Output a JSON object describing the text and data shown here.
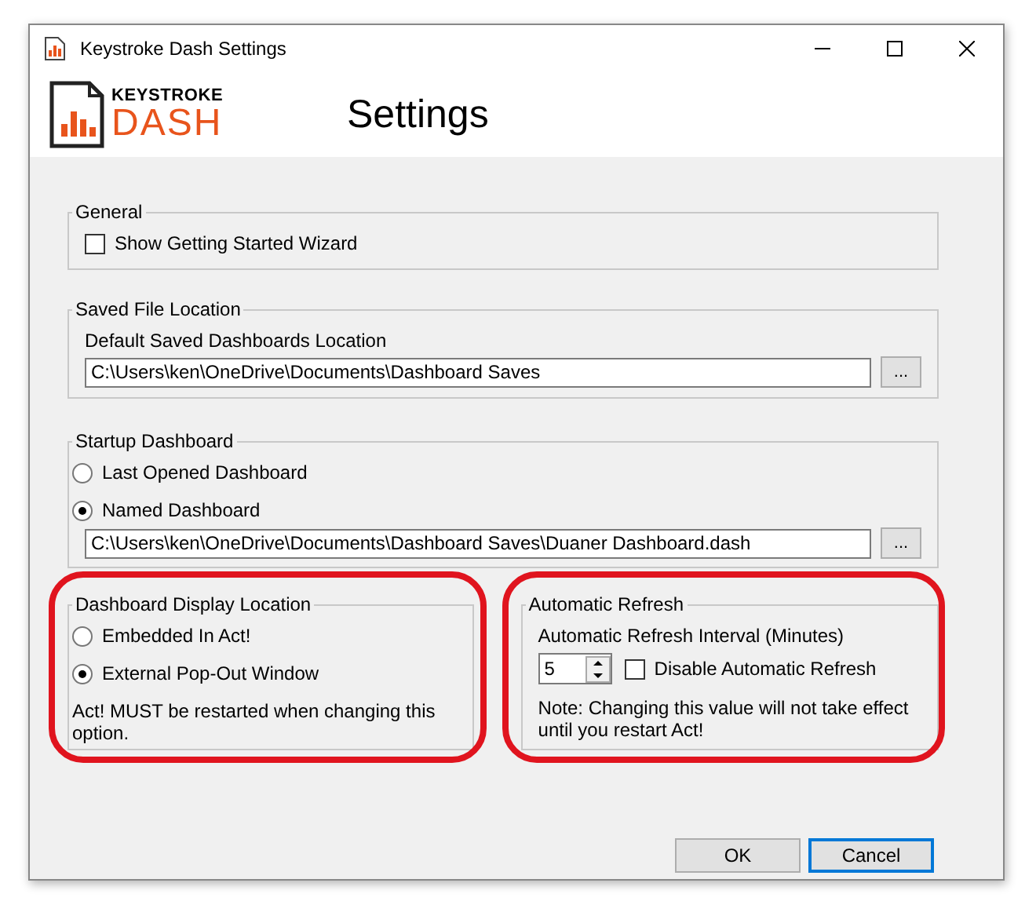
{
  "window": {
    "title": "Keystroke Dash Settings"
  },
  "header": {
    "logo_top": "KEYSTROKE",
    "logo_bottom": "DASH",
    "title": "Settings"
  },
  "general": {
    "title": "General",
    "highlighted": false,
    "show_wizard": {
      "label": "Show Getting Started Wizard",
      "checked": false
    }
  },
  "saved_file": {
    "title": "Saved File Location",
    "highlighted": false,
    "label": "Default Saved Dashboards Location",
    "path": "C:\\Users\\ken\\OneDrive\\Documents\\Dashboard Saves",
    "browse": "..."
  },
  "startup": {
    "title": "Startup Dashboard",
    "highlighted": false,
    "options": [
      {
        "label": "Last Opened Dashboard",
        "selected": false
      },
      {
        "label": "Named Dashboard",
        "selected": true
      }
    ],
    "path": "C:\\Users\\ken\\OneDrive\\Documents\\Dashboard Saves\\Duaner Dashboard.dash",
    "browse": "..."
  },
  "display_location": {
    "title": "Dashboard Display Location",
    "highlighted": true,
    "options": [
      {
        "label": "Embedded In Act!",
        "selected": false
      },
      {
        "label": "External Pop-Out Window",
        "selected": true
      }
    ],
    "note": "Act! MUST be restarted when changing this option."
  },
  "auto_refresh": {
    "title": "Automatic Refresh",
    "highlighted": true,
    "label": "Automatic Refresh Interval (Minutes)",
    "interval": "5",
    "disable": {
      "label": "Disable Automatic Refresh",
      "checked": false
    },
    "note": "Note: Changing this value will not take effect until you restart Act!"
  },
  "buttons": [
    {
      "label": "OK",
      "default": false
    },
    {
      "label": "Cancel",
      "default": true
    }
  ]
}
